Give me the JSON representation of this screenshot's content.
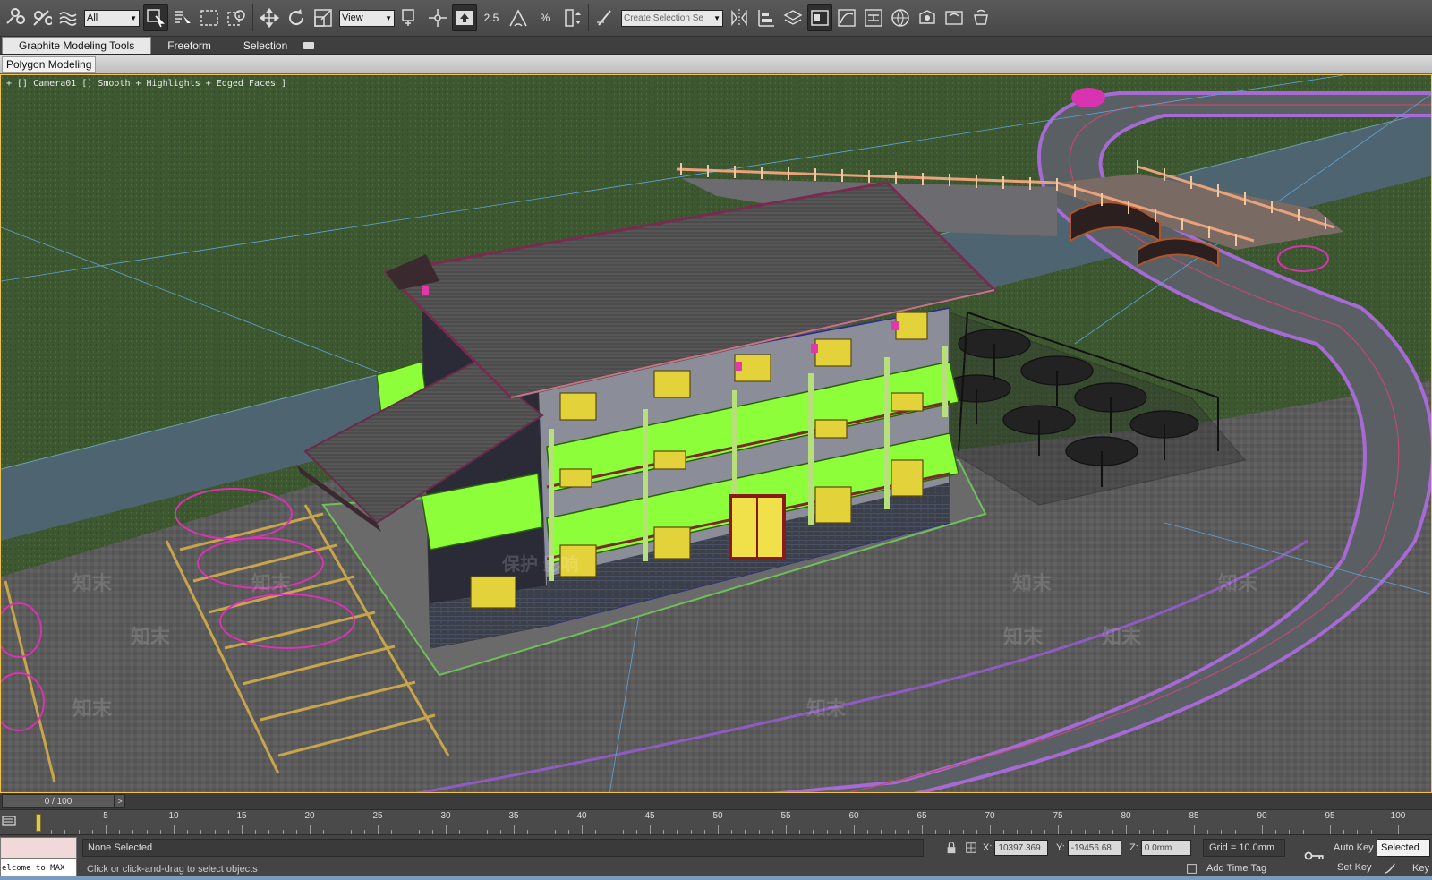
{
  "toolbar": {
    "selection_filter": "All",
    "ref_coord": "View",
    "snap_value": "2.5",
    "angle_snap": "%",
    "named_selection_placeholder": "Create Selection Se"
  },
  "ribbon": {
    "tabs": [
      "Graphite Modeling Tools",
      "Freeform",
      "Selection"
    ],
    "active_tab": "Graphite Modeling Tools",
    "panel": "Polygon Modeling"
  },
  "viewport": {
    "label": "+ [] Camera01 [] Smooth + Highlights + Edged Faces ]",
    "watermark_text": "知末",
    "watermark_line": "保护 影响",
    "colors": {
      "grass": "#3f5a32",
      "road": "#575c60",
      "river": "#4f6470",
      "roof": "#555555",
      "wall": "#8c8f9a",
      "balcony": "#8cff3a",
      "window": "#e4d23a",
      "road_edge": "#a76bd6",
      "plants": "#d833b0"
    }
  },
  "timeline": {
    "frame_display": "0 / 100",
    "next_label": ">",
    "ticks": [
      "5",
      "10",
      "15",
      "20",
      "25",
      "30",
      "35",
      "40",
      "45",
      "50",
      "55",
      "60",
      "65",
      "70",
      "75",
      "80",
      "85",
      "90",
      "95",
      "100"
    ]
  },
  "status": {
    "maxscript_text": "elcome to MAX",
    "selection": "None Selected",
    "prompt": "Click or click-and-drag to select objects",
    "x_label": "X:",
    "x_value": "10397.369",
    "y_label": "Y:",
    "y_value": "-19456.68",
    "z_label": "Z:",
    "z_value": "0.0mm",
    "grid": "Grid = 10.0mm",
    "add_time_tag": "Add Time Tag",
    "auto_key": "Auto Key",
    "set_key": "Set Key",
    "key_filter": "Selected",
    "key_filters_label": "Key"
  }
}
